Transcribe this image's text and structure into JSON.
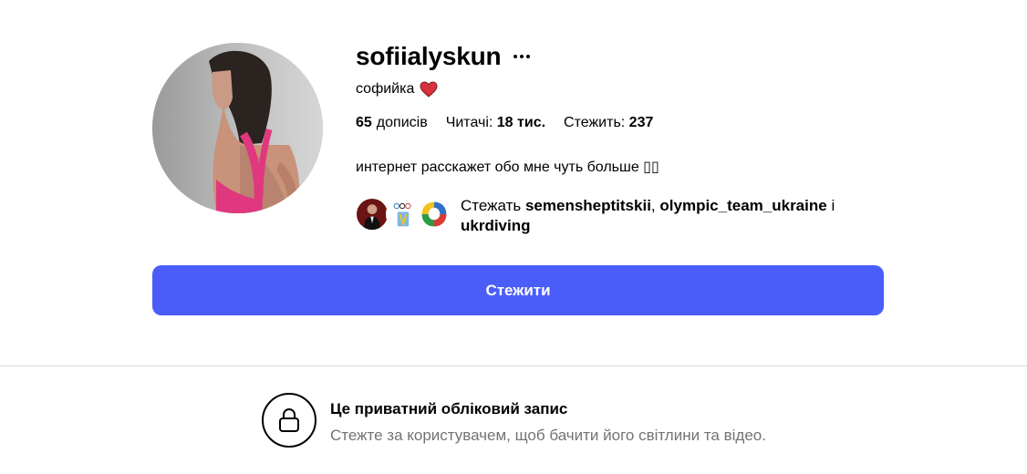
{
  "profile": {
    "username": "sofiialyskun",
    "full_name": "софийка",
    "stats": {
      "posts_count": "65",
      "posts_label": "дописів",
      "followers_label": "Читачі:",
      "followers_count": "18 тис.",
      "following_label": "Стежить:",
      "following_count": "237"
    },
    "bio": "интернет расскажет обо мне чуть больше ▯▯",
    "followed_by": {
      "prefix": "Стежать",
      "user1": "semensheptitskii",
      "sep": ",",
      "user2": "olympic_team_ukraine",
      "conj": "і",
      "user3": "ukrdiving"
    }
  },
  "follow_button": {
    "label": "Стежити"
  },
  "private": {
    "title": "Це приватний обліковий запис",
    "subtitle": "Стежте за користувачем, щоб бачити його світлини та відео."
  },
  "colors": {
    "accent": "#4a5df9",
    "heart": "#d9303e",
    "muted_text": "#737373",
    "divider": "#dbdbdb"
  },
  "icons": [
    "more-options-icon",
    "red-heart-icon",
    "lock-icon"
  ]
}
